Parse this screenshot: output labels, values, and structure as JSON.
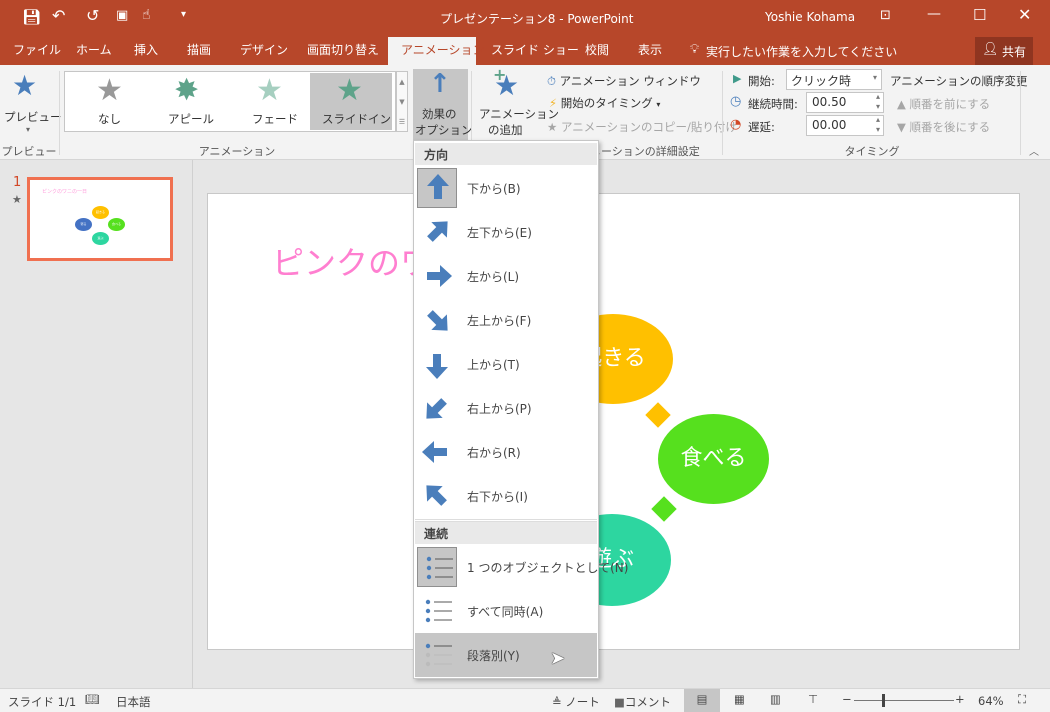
{
  "window": {
    "title": "プレゼンテーション8 - PowerPoint",
    "user": "Yoshie Kohama",
    "brand_color": "#b7472a"
  },
  "tabs": [
    "ファイル",
    "ホーム",
    "挿入",
    "描画",
    "デザイン",
    "画面切り替え",
    "アニメーション",
    "スライド ショー",
    "校閲",
    "表示"
  ],
  "tell_me": "実行したい作業を入力してください",
  "share": "共有",
  "ribbon": {
    "preview": {
      "button": "プレビュー",
      "group": "プレビュー"
    },
    "gallery": {
      "items": [
        "なし",
        "アピール",
        "フェード",
        "スライドイン"
      ],
      "selected": "スライドイン",
      "group": "アニメーション"
    },
    "effect_options": "効果の\nオプション",
    "effect_options_l1": "効果の",
    "effect_options_l2": "オプション",
    "add_animation_l1": "アニメーション",
    "add_animation_l2": "の追加",
    "animation_pane": "アニメーション ウィンドウ",
    "trigger": "開始のタイミング",
    "painter": "アニメーションのコピー/貼り付け",
    "advanced_group": "アニメーションの詳細設定",
    "timing": {
      "start_label": "開始:",
      "start_value": "クリック時",
      "duration_label": "継続時間:",
      "duration_value": "00.50",
      "delay_label": "遅延:",
      "delay_value": "00.00",
      "group": "タイミング"
    },
    "reorder": {
      "title": "アニメーションの順序変更",
      "earlier": "順番を前にする",
      "later": "順番を後にする"
    }
  },
  "thumbnail": {
    "number": "1",
    "title": "ピンクのワニの一日",
    "labels": [
      "起きる",
      "食べる",
      "遊ぶ",
      "寝る"
    ]
  },
  "slide": {
    "title": "ピンクのワニの一日",
    "shapes": [
      {
        "text": "起きる",
        "color": "#ffc000"
      },
      {
        "text": "食べる",
        "color": "#56e01e"
      },
      {
        "text": "遊ぶ",
        "color": "#2dd6a0"
      }
    ],
    "title_color": "#ff7fd0"
  },
  "menu": {
    "direction_header": "方向",
    "directions": [
      {
        "label": "下から(B)",
        "icon": "arrow-up-icon",
        "selected": true
      },
      {
        "label": "左下から(E)",
        "icon": "arrow-up-right-icon"
      },
      {
        "label": "左から(L)",
        "icon": "arrow-right-icon"
      },
      {
        "label": "左上から(F)",
        "icon": "arrow-down-right-icon"
      },
      {
        "label": "上から(T)",
        "icon": "arrow-down-icon"
      },
      {
        "label": "右上から(P)",
        "icon": "arrow-down-left-icon"
      },
      {
        "label": "右から(R)",
        "icon": "arrow-left-icon"
      },
      {
        "label": "右下から(I)",
        "icon": "arrow-up-left-icon"
      }
    ],
    "sequence_header": "連続",
    "sequences": [
      {
        "label": "1 つのオブジェクトとして(N)",
        "selected": true
      },
      {
        "label": "すべて同時(A)"
      },
      {
        "label": "段落別(Y)",
        "hovered": true
      }
    ]
  },
  "status": {
    "slide": "スライド 1/1",
    "language": "日本語",
    "notes": "ノート",
    "comments": "コメント",
    "zoom": "64%",
    "zoom_level": 64
  }
}
